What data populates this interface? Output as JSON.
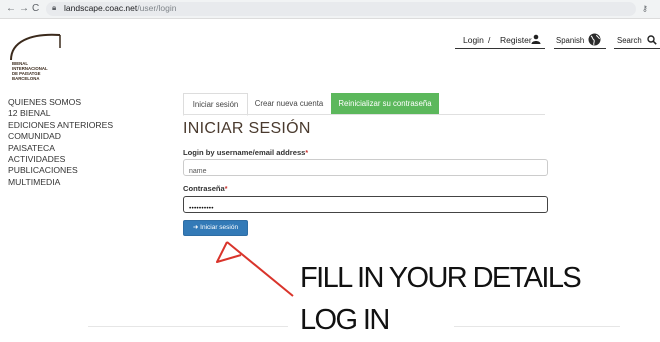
{
  "browser": {
    "url_host": "landscape.coac.net",
    "url_path": "/user/login",
    "back_icon": "arrow-left-icon",
    "forward_icon": "arrow-right-icon",
    "reload_icon": "reload-icon"
  },
  "logo": {
    "lines": [
      "BIENAL",
      "INTERNACIONAL",
      "DE PAISATGE",
      "BARCELONA"
    ]
  },
  "topnav": {
    "login": "Login",
    "separator": "/",
    "register": "Register",
    "language": "Spanish",
    "search": "Search"
  },
  "sidebar": {
    "items": [
      "QUIENES SOMOS",
      "12 BIENAL",
      "EDICIONES ANTERIORES",
      "COMUNIDAD",
      "PAISATECA",
      "ACTIVIDADES",
      "PUBLICACIONES",
      "MULTIMEDIA"
    ]
  },
  "tabs": [
    {
      "label": "Iniciar sesión"
    },
    {
      "label": "Crear nueva cuenta"
    },
    {
      "label": "Reinicializar su contraseña"
    }
  ],
  "form": {
    "heading": "INICIAR SESIÓN",
    "username_label": "Login by username/email address",
    "username_value": "name",
    "password_label": "Contraseña",
    "password_value": "••••••••••",
    "required_marker": "*",
    "submit_label": "Iniciar sesión"
  },
  "annotation": {
    "line1": "FILL IN YOUR DETAILS",
    "line2": "LOG IN",
    "color": "#d9342b"
  },
  "colors": {
    "accent_green": "#5cb85c",
    "button_blue": "#337ab7"
  }
}
